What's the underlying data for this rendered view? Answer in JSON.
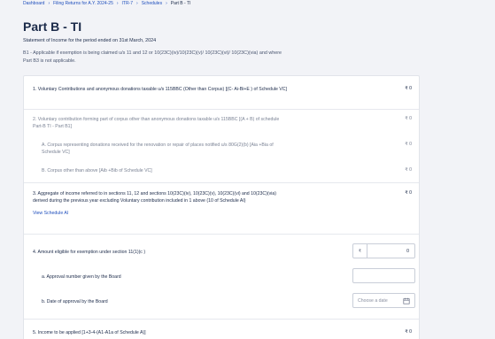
{
  "breadcrumb": {
    "items": [
      "Dashboard",
      "Filing Returns for A.Y. 2024-25",
      "ITR-7",
      "Schedules"
    ],
    "current": "Part B - TI",
    "separator": "›"
  },
  "page": {
    "title": "Part B - TI",
    "subtitle": "Statement of Income for the period ended on 31st March, 2024",
    "note": "B1 - Applicable if exemption is being claimed u/s 11 and 12 or 10(23C)(iv)/10(23C)(v)/ 10(23C)(vi)/ 10(23C)(via) and where Part B3 is not applicable."
  },
  "rows": {
    "r1": {
      "label": "1. Voluntary Contributions and anonymous donations taxable u/s 115BBC (Other than Corpus) [(C- Ai-Bi+E ) of Schedule VC]",
      "amount": "₹ 0"
    },
    "r2": {
      "label": "2. Voluntary contribution forming part of corpus other than anonymous donations taxable u/s 115BBC [(A + B) of schedule Part-B TI - Part B1]",
      "amount": "₹ 0"
    },
    "r2a": {
      "label": "A. Corpus representing donations received for the renovation or repair of places notified u/s 80G(2)(b) [Aia +Bia of Schedule VC]",
      "amount": "₹ 0"
    },
    "r2b": {
      "label": "B. Corpus other than above [Aib +Bib of Schedule VC]",
      "amount": "₹ 0"
    },
    "r3": {
      "label": "3. Aggregate of income referred to in sections 11, 12 and sections 10(23C)(iv), 10(23C)(v), 10(23C)(vi) and 10(23C)(via) derived during the previous year excluding Voluntary contribution included in 1 above (10 of Schedule AI)",
      "amount": "₹ 0",
      "link": "View Schedule AI"
    },
    "r4": {
      "label": "4. Amount eligible for exemption under section 11(1)(c )",
      "currency": "₹",
      "value": "0"
    },
    "r4a": {
      "label": "a. Approval number given by the Board",
      "value": ""
    },
    "r4b": {
      "label": "b. Date of approval by the Board",
      "placeholder": "Choose a date"
    },
    "r5": {
      "label": "5. Income to be applied [1+3-4-(A1-A1a of Schedule A)]",
      "amount": "₹ 0"
    }
  },
  "colors": {
    "link": "#1f4fbd",
    "text": "#1b2a49",
    "muted": "#7a8294",
    "background": "#f2f3f7"
  }
}
